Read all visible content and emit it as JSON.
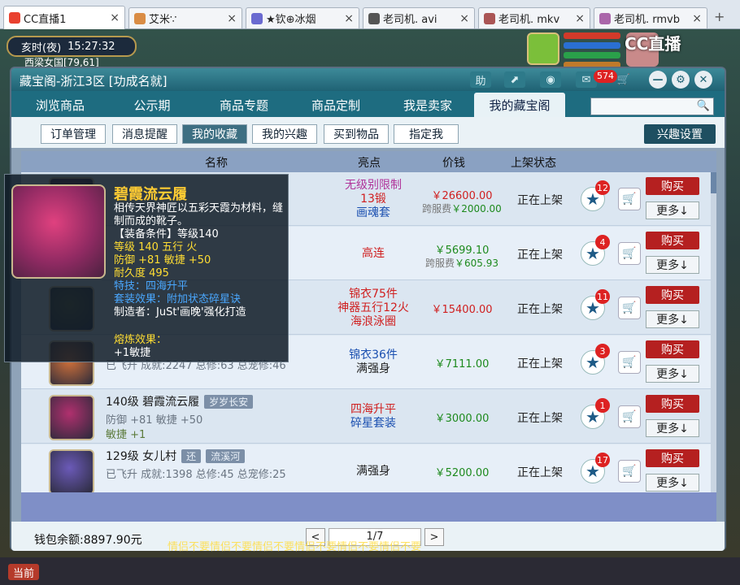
{
  "browser_tabs": [
    {
      "title": "CC直播1",
      "icon": "cc-icon",
      "color": "#e9412f",
      "active": true
    },
    {
      "title": "艾米∵",
      "icon": "avatar-icon",
      "color": "#d98c45"
    },
    {
      "title": "★钦⊕冰烟",
      "icon": "avatar-icon",
      "color": "#6a6ad0"
    },
    {
      "title": "老司机. avi",
      "icon": "avatar-icon",
      "color": "#555"
    },
    {
      "title": "老司机. mkv",
      "icon": "avatar-icon",
      "color": "#a55"
    },
    {
      "title": "老司机. rmvb",
      "icon": "avatar-icon",
      "color": "#a6a"
    }
  ],
  "new_tab": "+",
  "game": {
    "time_label": "亥时(夜)",
    "clock": "15:27:32",
    "location": "西梁女国[79,61]",
    "watermark": "CC直播",
    "scroll_text": "情侣不要情侣不要情侣不要情侣不要情侣不要情侣不要",
    "bottom_left_button": "当前"
  },
  "dialog": {
    "title": "藏宝阁-浙江3区 [功成名就]",
    "toolbar": {
      "help": "助",
      "share": "⬈",
      "stop": "◉",
      "message_count": "574"
    },
    "nav_tabs": [
      "浏览商品",
      "公示期",
      "商品专题",
      "商品定制",
      "我是卖家",
      "我的藏宝阁"
    ],
    "sub_tabs": [
      "订单管理",
      "消息提醒",
      "我的收藏",
      "我的兴趣",
      "买到物品",
      "指定我"
    ],
    "interest_settings": "兴趣设置",
    "columns": {
      "name": "名称",
      "highlight": "亮点",
      "price": "价钱",
      "status": "上架状态"
    },
    "rows": [
      {
        "name": "",
        "tag": "",
        "sub": "",
        "sub2": "",
        "highlight": [
          "无级别限制",
          "13锻",
          "画魂套"
        ],
        "highlight_colors": [
          "#b0349a",
          "#d02020",
          "#1a4fb0"
        ],
        "price": "￥26600.00",
        "cross": "跨服费",
        "cross_price": "￥2000.00",
        "status": "正在上架",
        "stars": "12",
        "icon_color": "#7a3b56"
      },
      {
        "name": "",
        "tag": "",
        "sub": "",
        "sub2": "",
        "highlight": [
          "高连"
        ],
        "highlight_colors": [
          "#d02020"
        ],
        "price": "￥5699.10",
        "cross": "跨服费",
        "cross_price": "￥605.93",
        "status": "正在上架",
        "stars": "4",
        "icon_color": "#5a5f78",
        "price_color": "#1d8a1d"
      },
      {
        "name": "",
        "tag": "",
        "sub": "",
        "sub2": "",
        "highlight": [
          "锦衣75件",
          "神器五行12火",
          "海浪泳圈"
        ],
        "highlight_colors": [
          "#d02020",
          "#d02020",
          "#d02020"
        ],
        "price": "￥15400.00",
        "cross": "",
        "cross_price": "",
        "status": "正在上架",
        "stars": "11",
        "icon_color": "#5b5a30"
      },
      {
        "name": "",
        "tag": "",
        "sub": "已飞升 成就:2247 总修:63 总宠修:46",
        "sub2": "",
        "highlight": [
          "锦衣36件",
          "满强身"
        ],
        "highlight_colors": [
          "#1a4fb0",
          "#222"
        ],
        "price": "￥7111.00",
        "cross": "",
        "cross_price": "",
        "status": "正在上架",
        "stars": "3",
        "icon_color": "#d8743a",
        "price_color": "#1d8a1d"
      },
      {
        "name": "140级 碧霞流云履",
        "tag": "岁岁长安",
        "sub": "防御 +81 敏捷 +50",
        "sub2": "敏捷 +1",
        "highlight": [
          "四海升平",
          "碎星套装"
        ],
        "highlight_colors": [
          "#d02020",
          "#1a4fb0"
        ],
        "price": "￥3000.00",
        "cross": "",
        "cross_price": "",
        "status": "正在上架",
        "stars": "1",
        "icon_color": "#b0306e",
        "price_color": "#1d8a1d"
      },
      {
        "name": "129级 女儿村",
        "tag": "还",
        "tag2": "流溪河",
        "sub": "已飞升 成就:1398 总修:45 总宠修:25",
        "sub2": "",
        "highlight": [
          "满强身"
        ],
        "highlight_colors": [
          "#222"
        ],
        "price": "￥5200.00",
        "cross": "",
        "cross_price": "",
        "status": "正在上架",
        "stars": "17",
        "icon_color": "#6b5ab8",
        "price_color": "#1d8a1d"
      }
    ],
    "buy_label": "购买",
    "more_label": "更多↓",
    "wallet": "钱包余额:8897.90元",
    "pager": {
      "prev": "<",
      "current": "1/7",
      "next": ">"
    }
  },
  "tooltip": {
    "name": "碧霞流云履",
    "desc": "相传天界神匠以五彩天霞为材料，缝制而成的靴子。",
    "lines": [
      {
        "text": "【装备条件】等级140",
        "color": "#ffffff"
      },
      {
        "text": "等级 140  五行 火",
        "color": "#ffdd33"
      },
      {
        "text": "防御 +81 敏捷 +50",
        "color": "#ffdd33"
      },
      {
        "text": "耐久度 495",
        "color": "#ffdd33"
      },
      {
        "text": "特技：四海升平",
        "color": "#4aa8ff"
      },
      {
        "text": "套装效果：附加状态碎星诀",
        "color": "#4aa8ff"
      }
    ],
    "maker": "制造者：JuSt'画晚'强化打造",
    "fusion_label": "熔炼效果：",
    "fusion_value": "+1敏捷",
    "fusion_color": "#ffdd33"
  }
}
